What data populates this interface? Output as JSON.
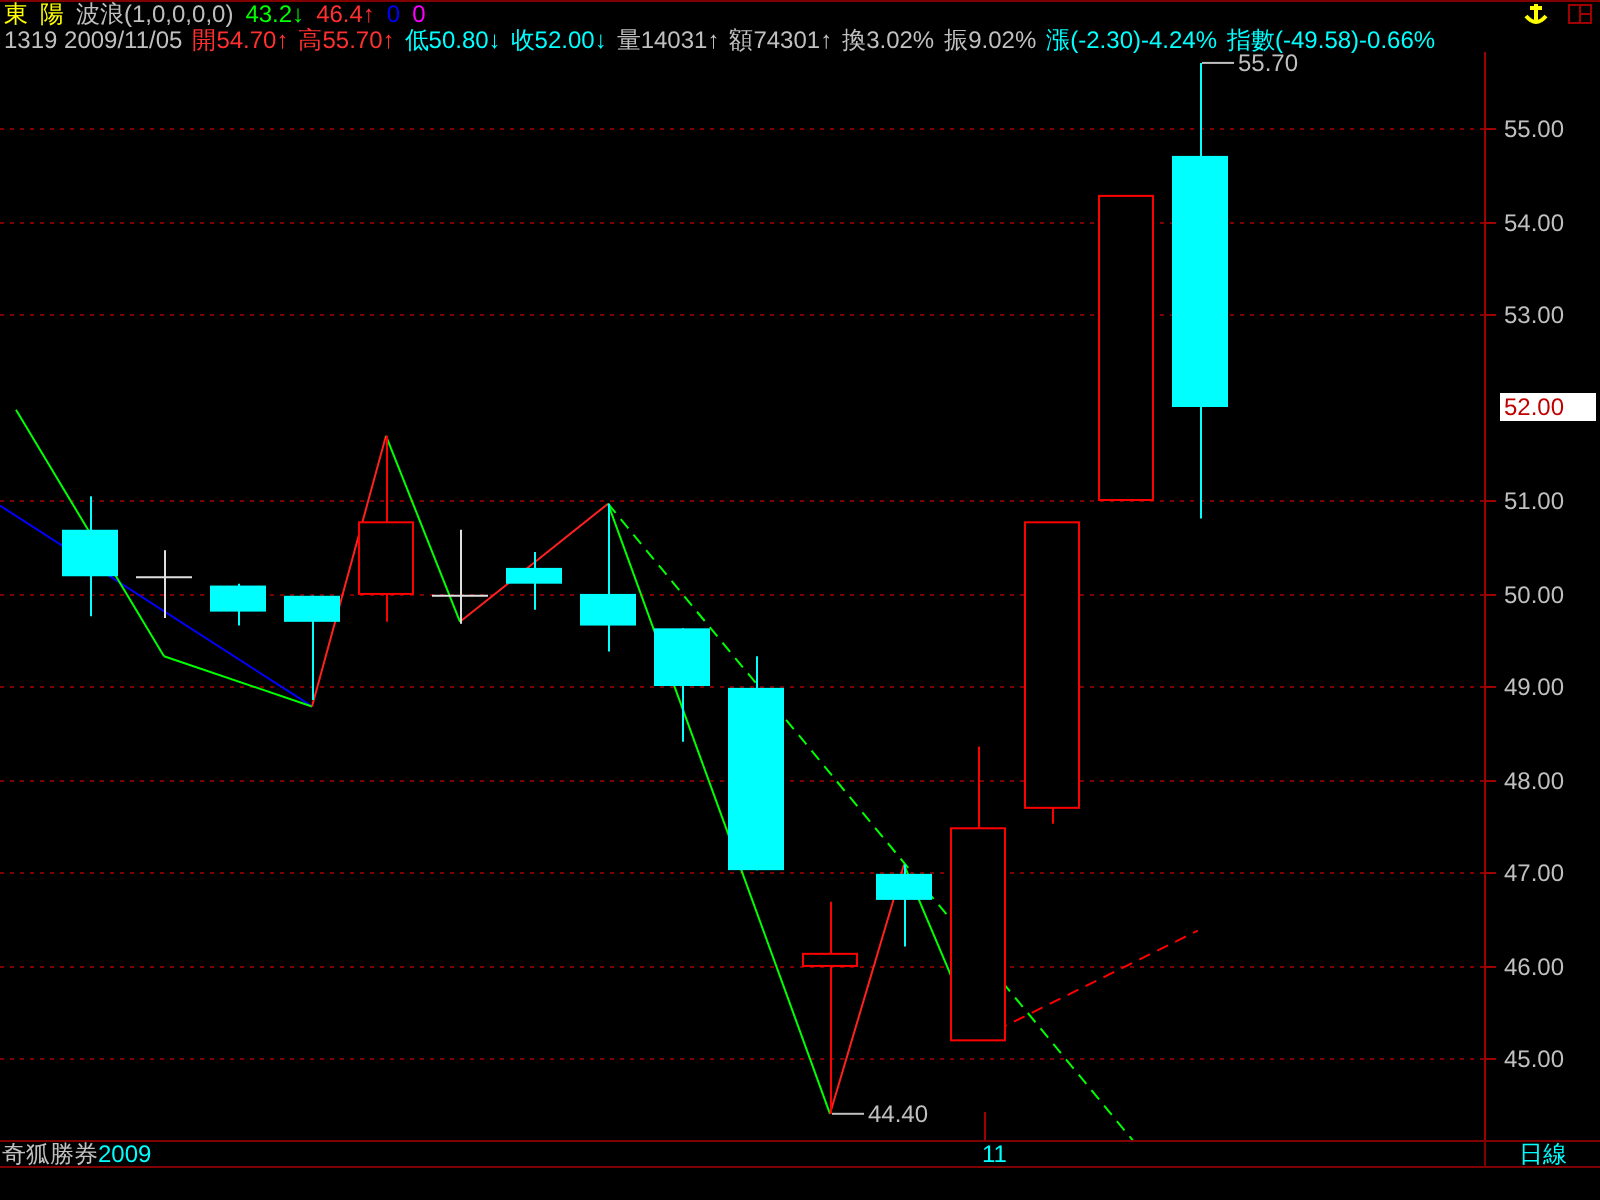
{
  "header": {
    "row_1": [
      {
        "text": "東",
        "color": "#ffff00"
      },
      {
        "text": "陽",
        "color": "#ffff00"
      },
      {
        "text": "波浪(1,0,0,0,0)",
        "color": "#c0c0c0"
      },
      {
        "text": "43.2↓",
        "color": "#00ff00"
      },
      {
        "text": "46.4↑",
        "color": "#ff3030"
      },
      {
        "text": "0",
        "color": "#0000ff"
      },
      {
        "text": "0",
        "color": "#ff00ff"
      }
    ],
    "row_2": [
      {
        "text": "1319 2009/11/05",
        "color": "#c0c0c0"
      },
      {
        "text": "開54.70↑",
        "color": "#ff3030"
      },
      {
        "text": "高55.70↑",
        "color": "#ff3030"
      },
      {
        "text": "低50.80↓",
        "color": "#00ffff"
      },
      {
        "text": "收52.00↓",
        "color": "#00ffff"
      },
      {
        "text": "量14031↑",
        "color": "#c0c0c0"
      },
      {
        "text": "額74301↑",
        "color": "#c0c0c0"
      },
      {
        "text": "換3.02%",
        "color": "#c0c0c0"
      },
      {
        "text": "振9.02%",
        "color": "#c0c0c0"
      },
      {
        "text": "漲(-2.30)-4.24%",
        "color": "#00ffff"
      },
      {
        "text": "指數(-49.58)-0.66%",
        "color": "#00ffff"
      }
    ]
  },
  "chart": {
    "price_axis": [
      "55.00",
      "54.00",
      "53.00",
      "51.00",
      "50.00",
      "49.00",
      "48.00",
      "47.00",
      "46.00",
      "45.00"
    ],
    "high_label": "55.70",
    "low_label": "44.40",
    "date_label": "11",
    "current_price": "52.00"
  },
  "footer": {
    "brand": "奇狐勝券",
    "year": "2009",
    "period": "日線"
  }
}
